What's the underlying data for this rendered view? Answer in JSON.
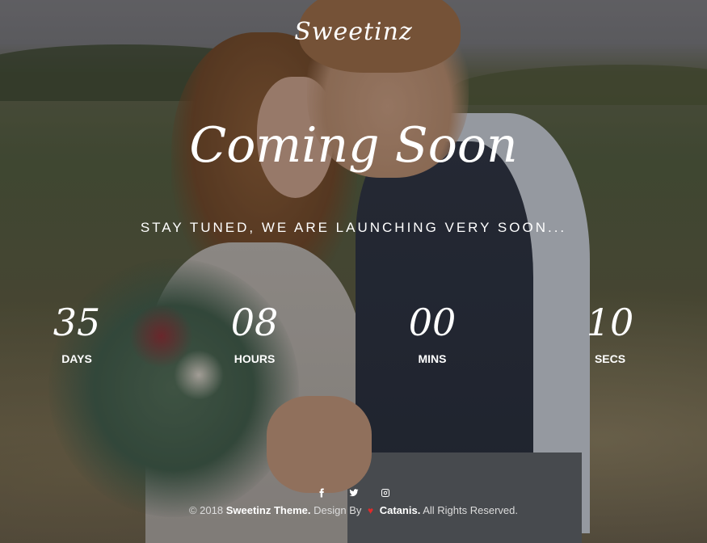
{
  "brand": {
    "logo_text": "Sweetinz"
  },
  "hero": {
    "heading": "Coming Soon",
    "tagline": "STAY TUNED, WE ARE LAUNCHING VERY SOON..."
  },
  "countdown": {
    "days": {
      "value": "35",
      "label": "DAYS"
    },
    "hours": {
      "value": "08",
      "label": "HOURS"
    },
    "mins": {
      "value": "00",
      "label": "MINS"
    },
    "secs": {
      "value": "10",
      "label": "SECS"
    }
  },
  "social": {
    "icons": [
      "facebook-icon",
      "twitter-icon",
      "instagram-icon"
    ]
  },
  "footer": {
    "copyright": "© 2018",
    "theme_name": "Sweetinz Theme.",
    "design_by": "Design By",
    "heart_icon": "heart-icon",
    "heart_color": "#e02a2a",
    "author": "Catanis.",
    "rights": "All Rights Reserved."
  }
}
